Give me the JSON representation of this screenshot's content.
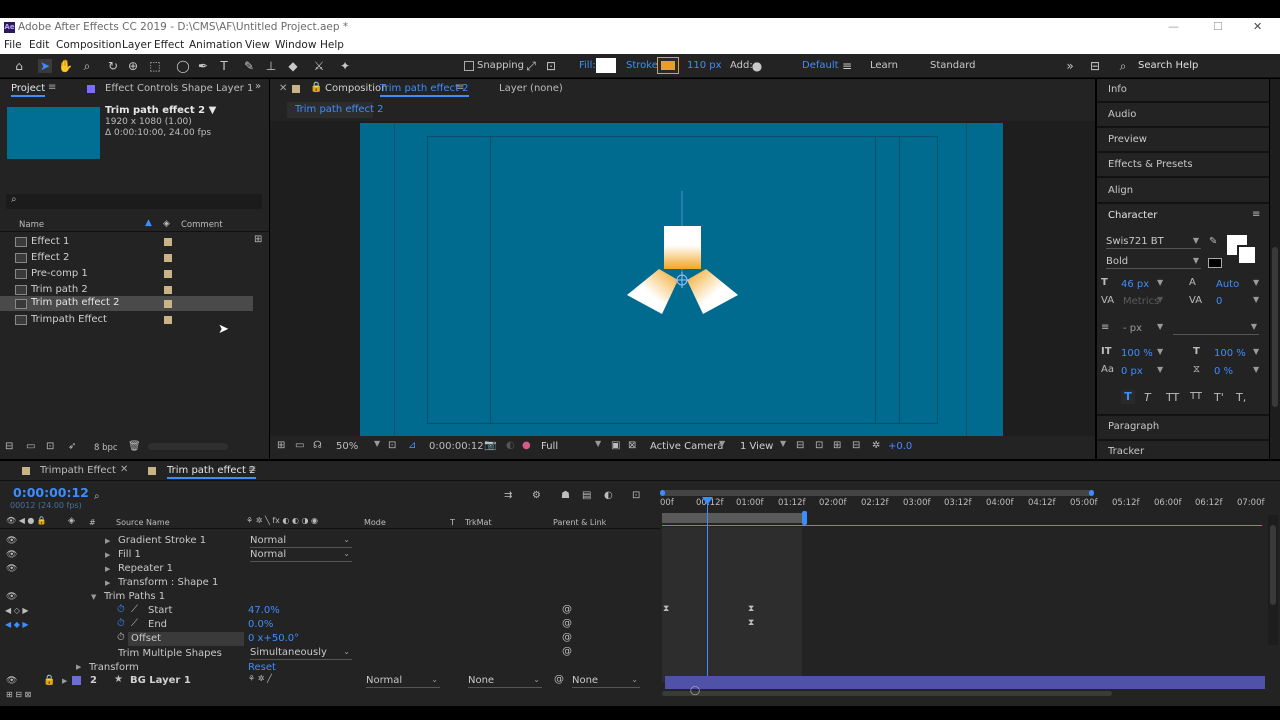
{
  "app": {
    "title": "Adobe After Effects CC 2019 - D:\\CMS\\AF\\Untitled Project.aep *",
    "logo": "Ae",
    "window_controls": [
      "—",
      "☐",
      "✕"
    ]
  },
  "menu": [
    "File",
    "Edit",
    "Composition",
    "Layer",
    "Effect",
    "Animation",
    "View",
    "Window",
    "Help"
  ],
  "toolbar": {
    "snapping_label": "Snapping",
    "fill_label": "Fill:",
    "stroke_label": "Stroke:",
    "stroke_width": "110 px",
    "add_label": "Add:",
    "workspaces": [
      "Default",
      "Learn",
      "Standard"
    ],
    "search_help": "Search Help"
  },
  "project_panel": {
    "tab_project": "Project",
    "tab_effect_controls": "Effect Controls Shape Layer 1",
    "comp_name": "Trim path effect 2 ▼",
    "comp_size": "1920 x 1080 (1.00)",
    "comp_duration": "Δ 0:00:10:00, 24.00 fps",
    "col_name": "Name",
    "col_comment": "Comment",
    "items": [
      "Effect 1",
      "Effect 2",
      "Pre-comp 1",
      "Trim path 2",
      "Trim path effect 2",
      "Trimpath Effect"
    ],
    "selected_index": 4,
    "bpc": "8 bpc"
  },
  "comp_panel": {
    "tab_label_prefix": "Composition",
    "tab_label_name": "Trim path effect 2",
    "layer_tab": "Layer  (none)",
    "breadcrumb": "Trim path effect 2",
    "zoom": "50%",
    "timecode": "0:00:00:12",
    "resolution": "Full",
    "camera": "Active Camera",
    "view": "1 View",
    "exposure": "+0.0"
  },
  "right_panel": {
    "items": [
      "Info",
      "Audio",
      "Preview",
      "Effects & Presets",
      "Align"
    ],
    "character_title": "Character",
    "font": "Swis721 BT",
    "style": "Bold",
    "size": "46 px",
    "leading": "Auto",
    "kerning": "Metrics",
    "tracking": "0",
    "stroke_w": "- px",
    "vscale": "100 %",
    "hscale": "100 %",
    "baseline": "0 px",
    "tsume": "0 %",
    "paragraph": "Paragraph",
    "tracker": "Tracker"
  },
  "timeline": {
    "tabs": [
      "Trimpath Effect",
      "Trim path effect 2"
    ],
    "active_tab": 1,
    "timecode": "0:00:00:12",
    "frame_info": "00012 (24.00 fps)",
    "col_source": "Source Name",
    "col_mode": "Mode",
    "col_t": "T",
    "col_trkmat": "TrkMat",
    "col_parent": "Parent & Link",
    "ruler": [
      "00f",
      "00:12f",
      "01:00f",
      "01:12f",
      "02:00f",
      "02:12f",
      "03:00f",
      "03:12f",
      "04:00f",
      "04:12f",
      "05:00f",
      "05:12f",
      "06:00f",
      "06:12f",
      "07:00f"
    ],
    "rows": [
      {
        "label": "Gradient Stroke 1",
        "mode": "Normal"
      },
      {
        "label": "Fill 1",
        "mode": "Normal"
      },
      {
        "label": "Repeater 1"
      },
      {
        "label": "Transform : Shape 1"
      },
      {
        "label": "Trim Paths 1"
      },
      {
        "label": "Start",
        "value": "47.0%"
      },
      {
        "label": "End",
        "value": "0.0%"
      },
      {
        "label": "Offset",
        "value": "0 x+50.0°"
      },
      {
        "label": "Trim Multiple Shapes",
        "mode": "Simultaneously"
      },
      {
        "label": "Transform",
        "value": "Reset"
      }
    ],
    "layer2": {
      "num": "2",
      "name": "BG Layer 1",
      "mode": "Normal",
      "trkmat": "None",
      "parent": "None"
    }
  },
  "colors": {
    "accent": "#3d8dff",
    "comp_bg": "#006b8f",
    "panel": "#232323",
    "orange": "#f2a623"
  }
}
